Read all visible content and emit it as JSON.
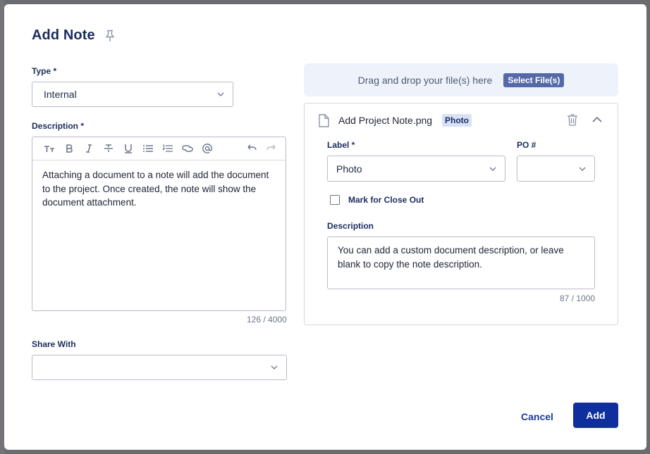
{
  "dialog": {
    "title": "Add Note"
  },
  "type_field": {
    "label": "Type *",
    "value": "Internal"
  },
  "description_field": {
    "label": "Description *",
    "text": "Attaching a document to a note will add the document to the project. Once created, the note will show the document attachment.",
    "counter": "126 / 4000",
    "toolbar": [
      "text-size-icon",
      "bold-icon",
      "italic-icon",
      "strikethrough-icon",
      "underline-icon",
      "bullet-list-icon",
      "numbered-list-icon",
      "link-icon",
      "mention-icon",
      "undo-icon",
      "redo-icon"
    ]
  },
  "share_with": {
    "label": "Share With",
    "value": ""
  },
  "dropzone": {
    "text": "Drag and drop your file(s) here",
    "button": "Select File(s)"
  },
  "file": {
    "name": "Add Project Note.png",
    "badge": "Photo",
    "label_field": {
      "label": "Label *",
      "value": "Photo"
    },
    "po_field": {
      "label": "PO #",
      "value": ""
    },
    "close_out": {
      "label": "Mark for Close Out",
      "checked": false
    },
    "description": {
      "label": "Description",
      "text": "You can add a custom document description, or leave blank to copy the note description.",
      "counter": "87 / 1000"
    }
  },
  "actions": {
    "cancel": "Cancel",
    "add": "Add"
  }
}
